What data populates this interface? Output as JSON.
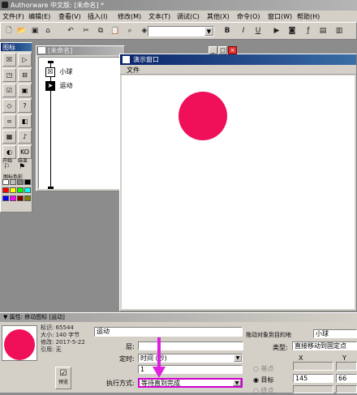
{
  "app": {
    "title": "Authorware 中文版: [未命名] *"
  },
  "menu": [
    "文件(F)",
    "编辑(E)",
    "查看(V)",
    "插入(I)",
    "修改(M)",
    "文本(T)",
    "调试(C)",
    "其他(X)",
    "命令(O)",
    "窗口(W)",
    "帮助(H)"
  ],
  "toolbar": {
    "style_select": "",
    "bold": "B",
    "italic": "I",
    "underline": "U"
  },
  "icon_palette": {
    "title": "图标",
    "start_label": "开始",
    "end_label": "结束",
    "color_label": "图标色彩",
    "colors": [
      "#ffffff",
      "#c0c0c0",
      "#808080",
      "#000000",
      "#ff0000",
      "#ffff00",
      "#00ff00",
      "#00ffff",
      "#0000ff",
      "#ff00ff",
      "#800000",
      "#808000"
    ]
  },
  "flowline": {
    "title": "[未命名]",
    "items": [
      {
        "label": "小球",
        "icon": "display-icon"
      },
      {
        "label": "运动",
        "icon": "motion-icon"
      }
    ]
  },
  "presentation": {
    "title": "演示窗口",
    "menu_file": "文件",
    "ball_color": "#f0105a"
  },
  "properties": {
    "title": "属性: 移动图标 [运动]",
    "info": {
      "id": "标识: 65544",
      "size": "大小: 140 字节",
      "modified": "修改: 2017-5-22",
      "refs": "引用: 无"
    },
    "preview_button": "预览",
    "name_value": "运动",
    "layer_label": "层:",
    "layer_value": "",
    "timing_label": "定时:",
    "timing_value": "时间 (秒)",
    "duration_value": "1",
    "exec_label": "执行方式:",
    "exec_value": "等待直到完成",
    "drag_label": "拖动对象到目的地",
    "object_value": "小球",
    "type_label": "类型:",
    "type_value": "直接移动到固定点",
    "col_x": "X",
    "col_y": "Y",
    "radio_base": "基点",
    "radio_target": "目标",
    "radio_end": "终点",
    "target_x": "145",
    "target_y": "66"
  }
}
